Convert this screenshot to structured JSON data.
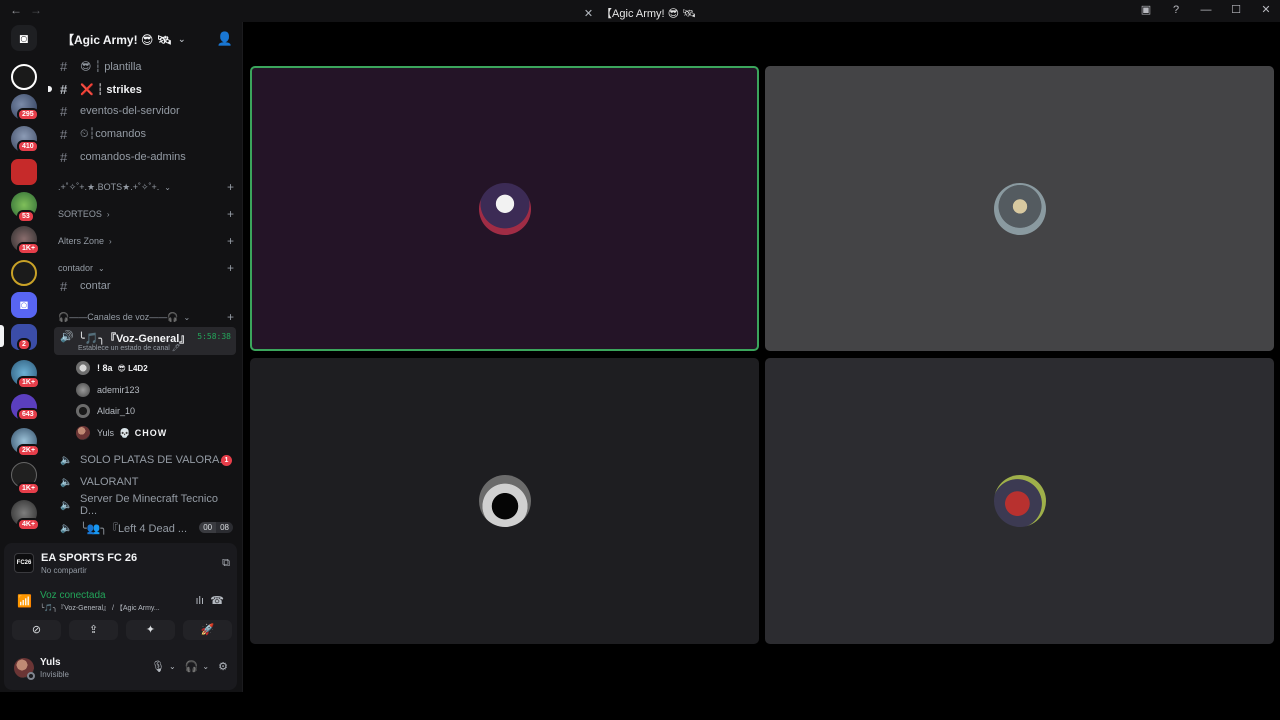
{
  "window": {
    "title": "【Agic Army! 😎 🛰",
    "nav_back": "←",
    "nav_forward": "→",
    "controls": [
      "▣",
      "?",
      "—",
      "☐",
      "✕"
    ]
  },
  "servers": [
    {
      "badge": ""
    },
    {
      "badge": "295"
    },
    {
      "badge": "410"
    },
    {
      "badge": ""
    },
    {
      "badge": "53"
    },
    {
      "badge": "1K+"
    },
    {
      "badge": ""
    },
    {
      "badge": ""
    },
    {
      "badge": "2"
    },
    {
      "badge": "1K+"
    },
    {
      "badge": "643"
    },
    {
      "badge": "2K+"
    },
    {
      "badge": "1K+"
    },
    {
      "badge": "4K+"
    }
  ],
  "guild": {
    "name": "【Agic Army! 😎 🛰",
    "caret": "⌄",
    "invite_icon": "person-add"
  },
  "channels": [
    {
      "label": "😎 ┆ plantilla",
      "active": false
    },
    {
      "label": "❌ ┆ strikes",
      "active": true
    },
    {
      "label": "eventos-del-servidor",
      "active": false
    },
    {
      "label": "⏲┆comandos",
      "active": false
    },
    {
      "label": "comandos-de-admins",
      "active": false
    }
  ],
  "categories": {
    "bots": ".+˚✧˚+.★.BOTS★.+˚✧˚+.",
    "sorteos": "SORTEOS",
    "alters": "Alters Zone",
    "contador": "contador",
    "voz": "🎧——Canales de voz——🎧"
  },
  "contar_channel": "contar",
  "voice_active": {
    "name": "╰🎵╮『Voz-General』",
    "time": "5:58:38",
    "status": "Establece un estado de canal 🖊"
  },
  "voice_users": [
    {
      "name": "! 8a",
      "tag": "😎 L4D2"
    },
    {
      "name": "ademir123",
      "tag": ""
    },
    {
      "name": "Aldair_10",
      "tag": ""
    },
    {
      "name": "Yuls",
      "tag": "💀 CHOW"
    }
  ],
  "voice_channels": [
    {
      "label": "SOLO PLATAS DE VALORA...",
      "badge": "1"
    },
    {
      "label": "VALORANT",
      "badge": ""
    },
    {
      "label": "Server De Minecraft Tecnico D...",
      "badge": ""
    },
    {
      "label": "╰👥╮『Left 4 Dead ...",
      "badge": ""
    }
  ],
  "l4d_counts": [
    "00",
    "08"
  ],
  "activity": {
    "icon_text": "FC26",
    "name": "EA SPORTS FC 26",
    "sub": "No compartir"
  },
  "voice_connection": {
    "title": "Voz conectada",
    "sub": "╰🎵╮『Voz-General』 / 【Agic Army..."
  },
  "action_buttons": [
    "⊘",
    "⇪",
    "✦",
    "🚀"
  ],
  "user": {
    "name": "Yuls",
    "status": "Invisible"
  },
  "colors": {
    "speaking_border": "#3ba55c",
    "tile1_bg": "#241427",
    "tile_gray": "#444446",
    "tile_dark": "#1e1e21",
    "voice_green": "#23a55a",
    "badge_red": "#e63e4a"
  }
}
